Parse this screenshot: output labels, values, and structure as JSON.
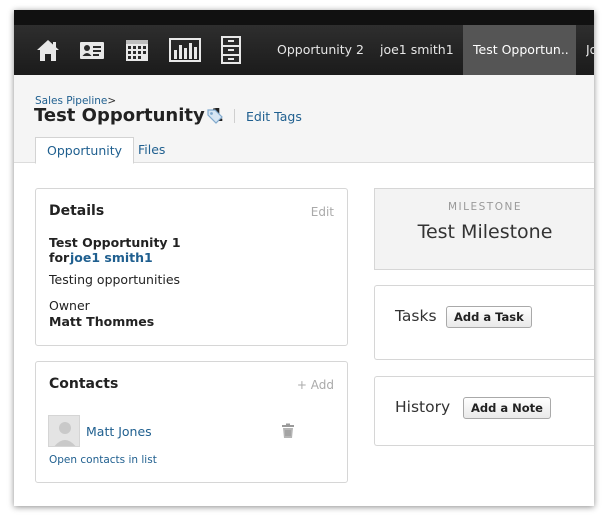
{
  "nav": {
    "icons": [
      "home-icon",
      "contact-card-icon",
      "calendar-icon",
      "bar-chart-icon",
      "cabinet-icon"
    ],
    "tabs": [
      "Opportunity 2",
      "joe1 smith1",
      "Test Opportun..",
      "Jo"
    ],
    "active_tab": 2
  },
  "header": {
    "breadcrumb": "Sales Pipeline",
    "breadcrumb_sep": ">",
    "title": "Test Opportunity 1",
    "edit_tags": "Edit Tags",
    "tabs": [
      "Opportunity",
      "Files"
    ]
  },
  "details": {
    "title": "Details",
    "edit": "Edit",
    "opportunity_name": "Test Opportunity 1",
    "for_label": "for",
    "for_party": "joe1 smith1",
    "description": "Testing opportunities",
    "owner_label": "Owner",
    "owner_name": "Matt Thommes"
  },
  "contacts": {
    "title": "Contacts",
    "add": "+ Add",
    "items": [
      {
        "name": "Matt Jones"
      }
    ],
    "open_list": "Open contacts in list"
  },
  "milestone": {
    "label": "MILESTONE",
    "value": "Test Milestone"
  },
  "tasks": {
    "title": "Tasks",
    "button": "Add a Task"
  },
  "history": {
    "title": "History",
    "button": "Add a Note"
  },
  "colors": {
    "link": "#1f5f8f",
    "topbar": "#222222",
    "active_tab": "#555555"
  }
}
